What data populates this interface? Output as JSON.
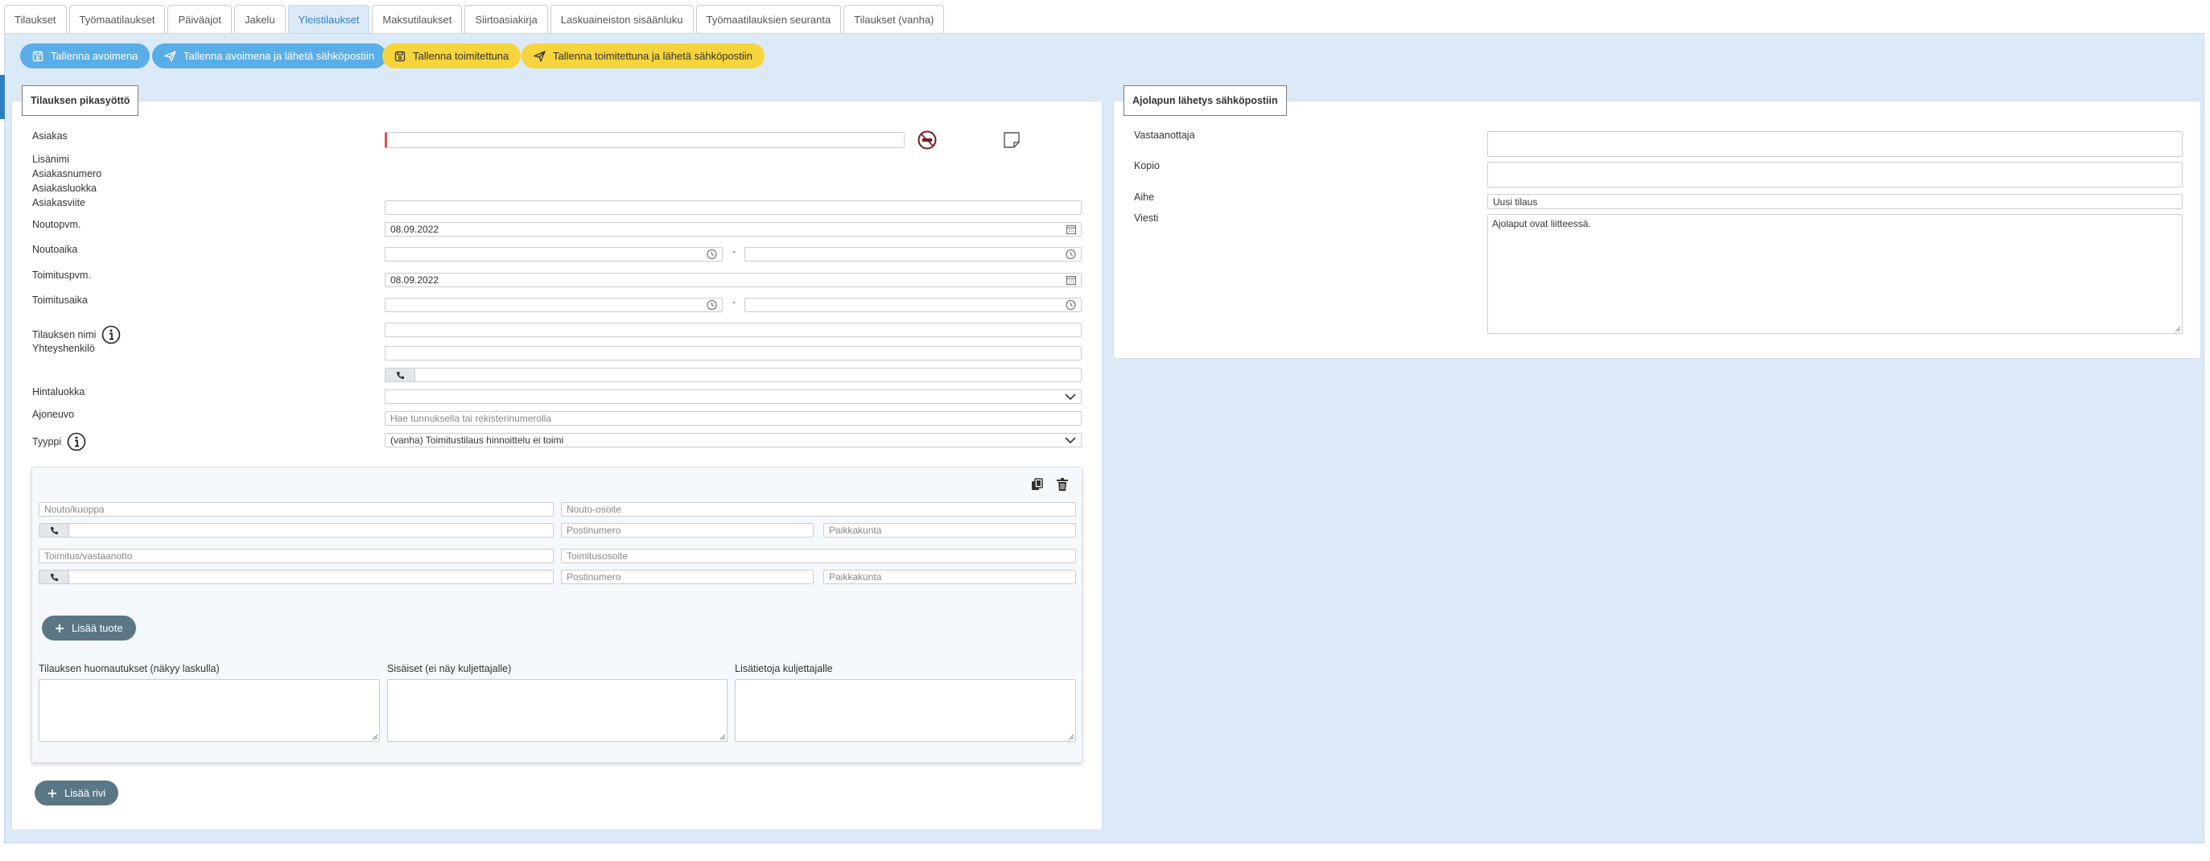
{
  "tabs": [
    {
      "label": "Tilaukset",
      "active": false
    },
    {
      "label": "Työmaatilaukset",
      "active": false
    },
    {
      "label": "Päiväajot",
      "active": false
    },
    {
      "label": "Jakelu",
      "active": false
    },
    {
      "label": "Yleistilaukset",
      "active": true
    },
    {
      "label": "Maksutilaukset",
      "active": false
    },
    {
      "label": "Siirtoasiakirja",
      "active": false
    },
    {
      "label": "Laskuaineiston sisäänluku",
      "active": false
    },
    {
      "label": "Työmaatilauksien seuranta",
      "active": false
    },
    {
      "label": "Tilaukset (vanha)",
      "active": false
    }
  ],
  "actions": {
    "save_open": "Tallenna avoimena",
    "save_open_email": "Tallenna avoimena ja lähetä sähköpostiin",
    "save_delivered": "Tallenna toimitettuna",
    "save_delivered_email": "Tallenna toimitettuna ja lähetä sähköpostiin"
  },
  "quick_entry": {
    "legend": "Tilauksen pikasyöttö",
    "labels": {
      "customer": "Asiakas",
      "extra_name": "Lisänimi",
      "customer_number": "Asiakasnumero",
      "customer_class": "Asiakasluokka",
      "customer_reference": "Asiakasviite",
      "pickup_date": "Noutopvm.",
      "pickup_time": "Noutoaika",
      "delivery_date": "Toimituspvm.",
      "delivery_time": "Toimitusaika",
      "order_name": "Tilauksen nimi",
      "contact_person": "Yhteyshenkilö",
      "price_class": "Hintaluokka",
      "vehicle": "Ajoneuvo",
      "type": "Tyyppi"
    },
    "values": {
      "customer": "",
      "customer_reference": "",
      "pickup_date": "08.09.2022",
      "delivery_date": "08.09.2022",
      "price_class": "",
      "type": "(vanha) Toimitustilaus hinnoittelu ei toimi"
    },
    "placeholders": {
      "vehicle": "Hae tunnuksella tai rekisterinumerolla"
    },
    "time_separator": "-"
  },
  "row_block": {
    "pickup_place_ph": "Nouto/kuoppa",
    "pickup_address_ph": "Nouto-osoite",
    "postcode_ph": "Postinumero",
    "city_ph": "Paikkakunta",
    "delivery_receiver_ph": "Toimitus/vastaanotto",
    "delivery_address_ph": "Toimitusosoite",
    "add_product": "Lisää tuote",
    "notes_invoice": "Tilauksen huomautukset (näkyy laskulla)",
    "notes_internal": "Sisäiset (ei näy kuljettajalle)",
    "notes_driver": "Lisätietoja kuljettajalle"
  },
  "add_row": "Lisää rivi",
  "email_panel": {
    "legend": "Ajolapun lähetys sähköpostiin",
    "labels": {
      "recipient": "Vastaanottaja",
      "copy": "Kopio",
      "subject": "Aihe",
      "message": "Viesti"
    },
    "values": {
      "recipient": "",
      "copy": "",
      "subject": "Uusi tilaus",
      "message": "Ajolaput ovat liitteessä."
    }
  },
  "colors": {
    "active_tab_bg": "#dbeaf6",
    "active_tab_text": "#2e7fc2",
    "primary_button": "#5aaee8",
    "warning_button": "#f6d43c",
    "pill_button": "#5b7785",
    "required_marker": "#d9534f",
    "workarea_bg": "#dbeaf6"
  },
  "icons": [
    "save-icon",
    "send-icon",
    "calendar-icon",
    "clock-icon",
    "phone-icon",
    "info-icon",
    "no-entry-icon",
    "note-icon",
    "copy-icon",
    "trash-icon",
    "plus-icon",
    "chevron-down-icon"
  ]
}
